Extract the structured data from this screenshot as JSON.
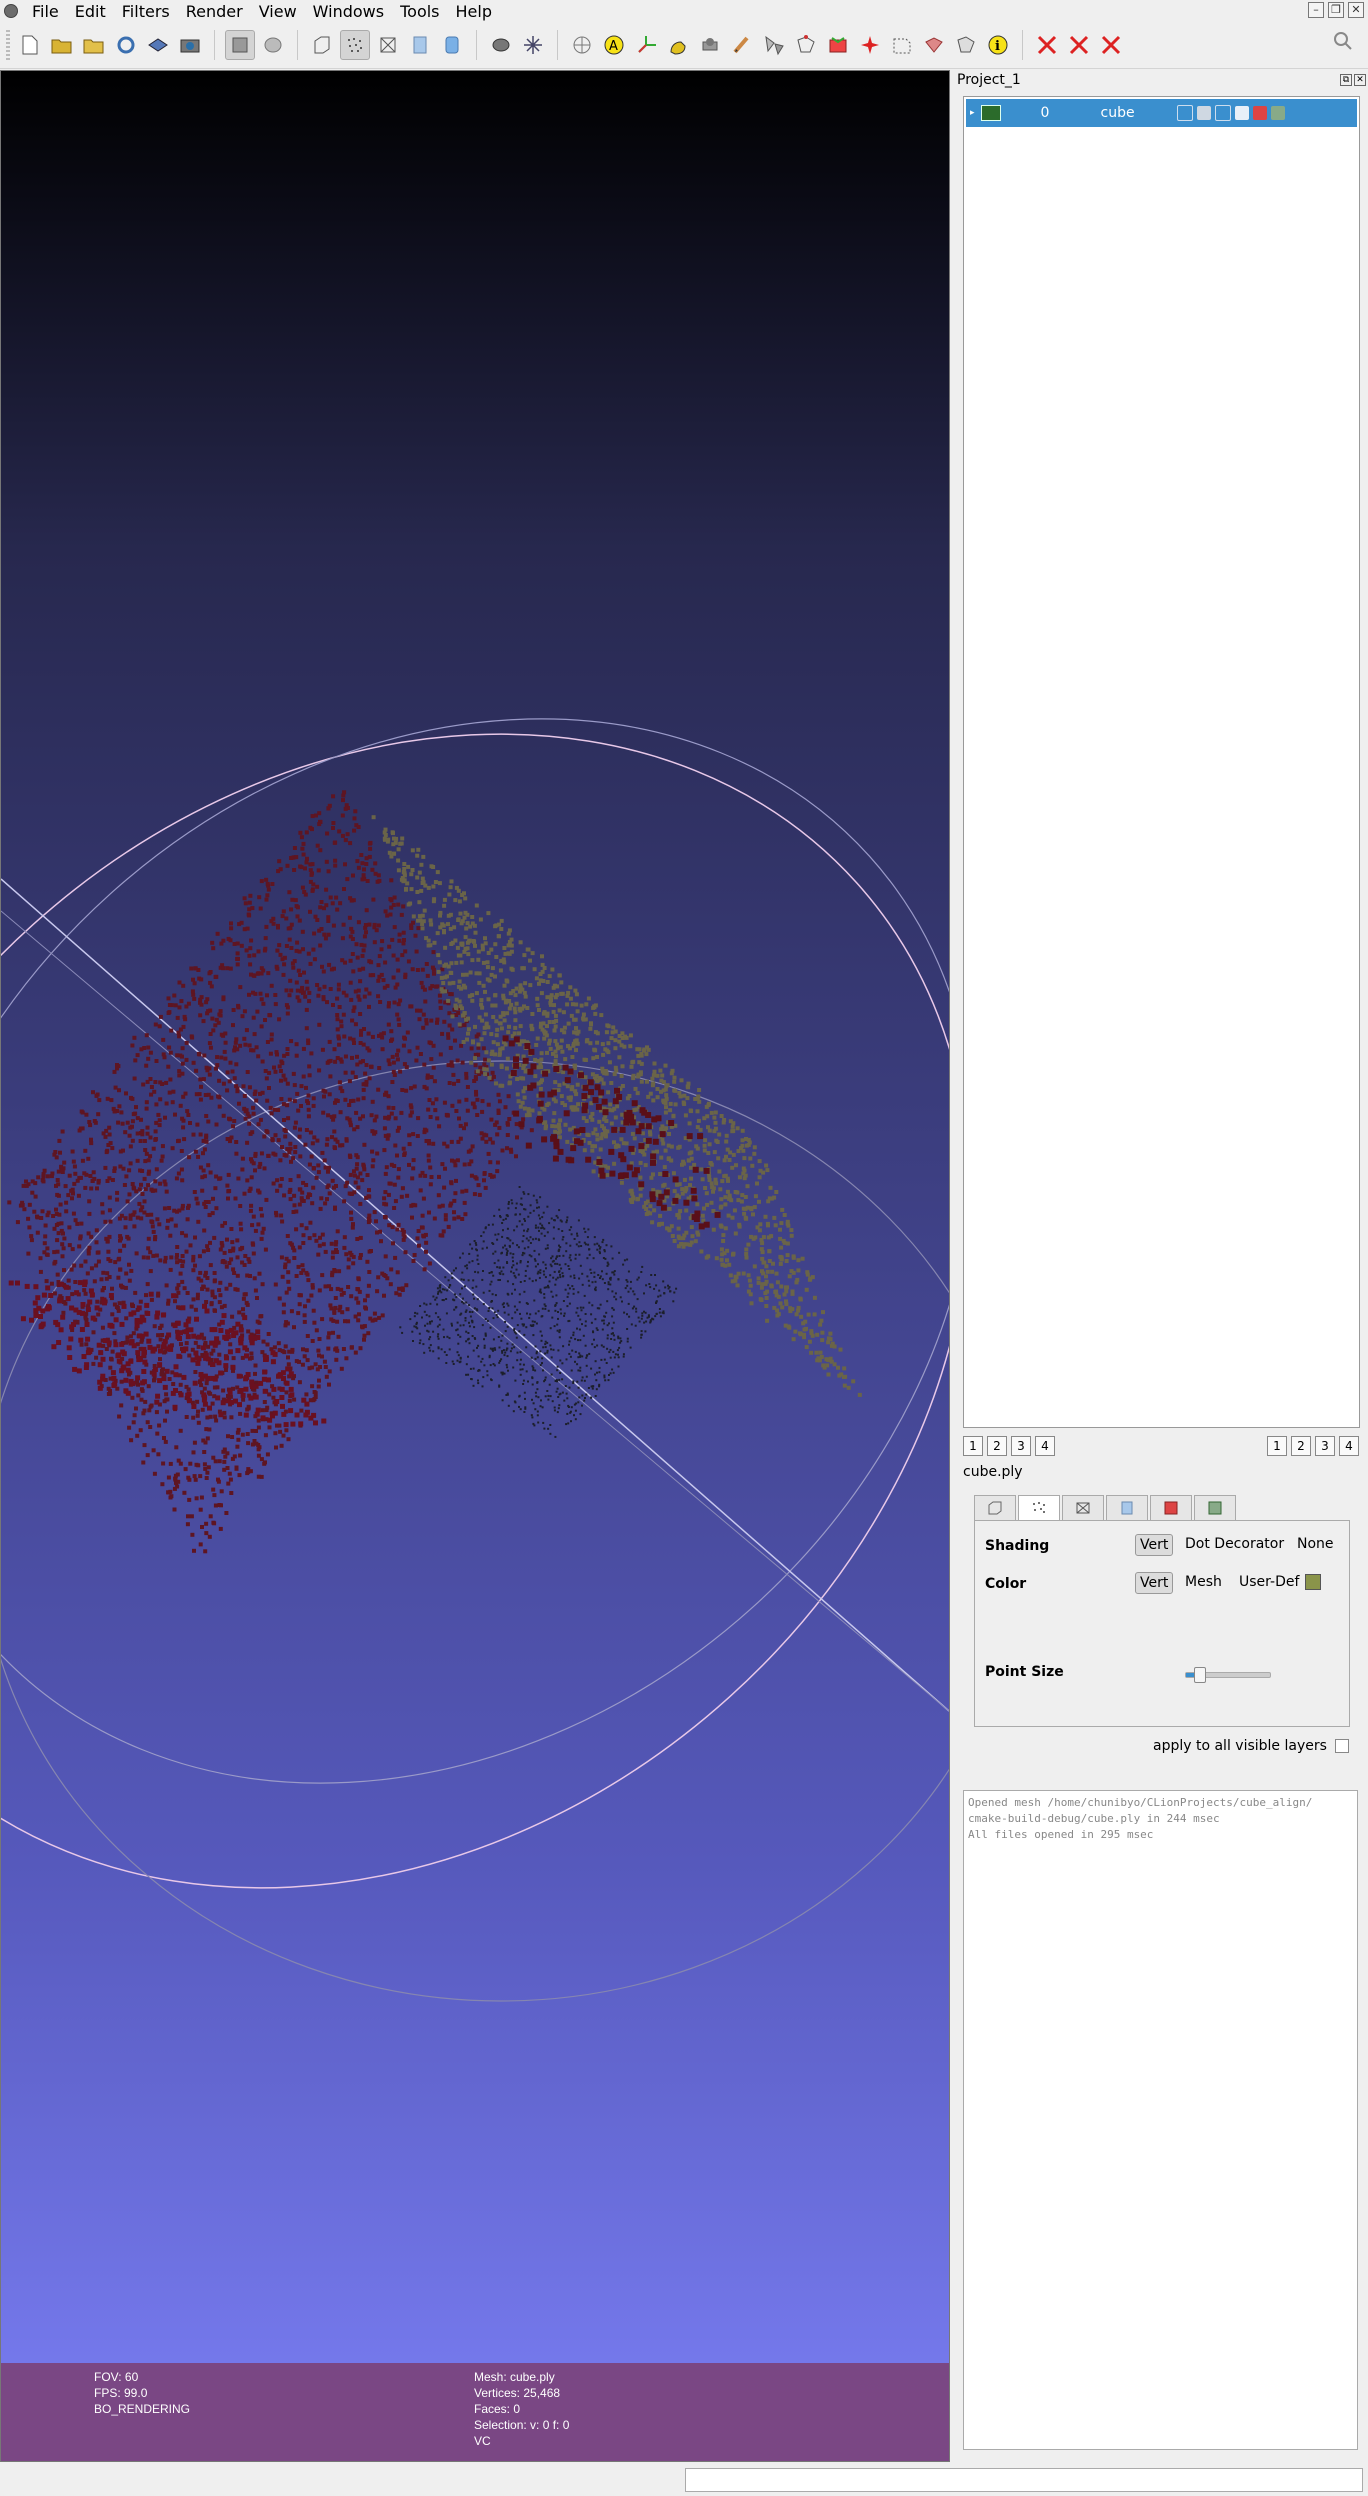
{
  "menu": {
    "items": [
      "File",
      "Edit",
      "Filters",
      "Render",
      "View",
      "Windows",
      "Tools",
      "Help"
    ]
  },
  "toolbar": {
    "icons": [
      "new-project-icon",
      "open-project-icon",
      "open-mesh-icon",
      "reload-icon",
      "save-icon",
      "snapshot-icon",
      "bbox-icon",
      "points-icon",
      "wire-icon",
      "flat-icon",
      "smooth-icon",
      "texture-icon",
      "layers-icon",
      "align-icon",
      "manipulator-icon",
      "pick-points-icon",
      "annotation-icon",
      "axis-icon",
      "paint-icon",
      "brush-icon",
      "measure-icon",
      "select-faces-icon",
      "select-vertices-icon",
      "georef-icon",
      "move-selection-icon",
      "select-polygon-icon",
      "select-connected-icon",
      "info-icon",
      "delete-faces-icon",
      "delete-vertices-icon",
      "delete-all-icon",
      "search-icon"
    ]
  },
  "viewport": {
    "info_left": [
      "FOV: 60",
      "FPS:    99.0",
      "BO_RENDERING"
    ],
    "info_right": [
      "Mesh: cube.ply",
      "Vertices: 25,468",
      "Faces: 0",
      "Selection: v: 0 f: 0",
      "VC"
    ]
  },
  "dock": {
    "title": "Project_1",
    "layer": {
      "index": "0",
      "name": "cube"
    },
    "num_buttons_left": [
      "1",
      "2",
      "3",
      "4"
    ],
    "num_buttons_right": [
      "1",
      "2",
      "3",
      "4"
    ],
    "filename": "cube.ply",
    "render": {
      "shading_label": "Shading",
      "shading_options": [
        "Vert",
        "Dot Decorator",
        "None"
      ],
      "color_label": "Color",
      "color_options": [
        "Vert",
        "Mesh",
        "User-Def"
      ],
      "user_color": "#8a944a",
      "point_size_label": "Point Size",
      "point_size_level": 0.15
    },
    "apply_label": "apply to all visible layers",
    "log": [
      "Opened mesh /home/chunibyo/CLionProjects/cube_align/",
      "cmake-build-debug/cube.ply in 244 msec",
      "All files opened in 295 msec"
    ]
  }
}
